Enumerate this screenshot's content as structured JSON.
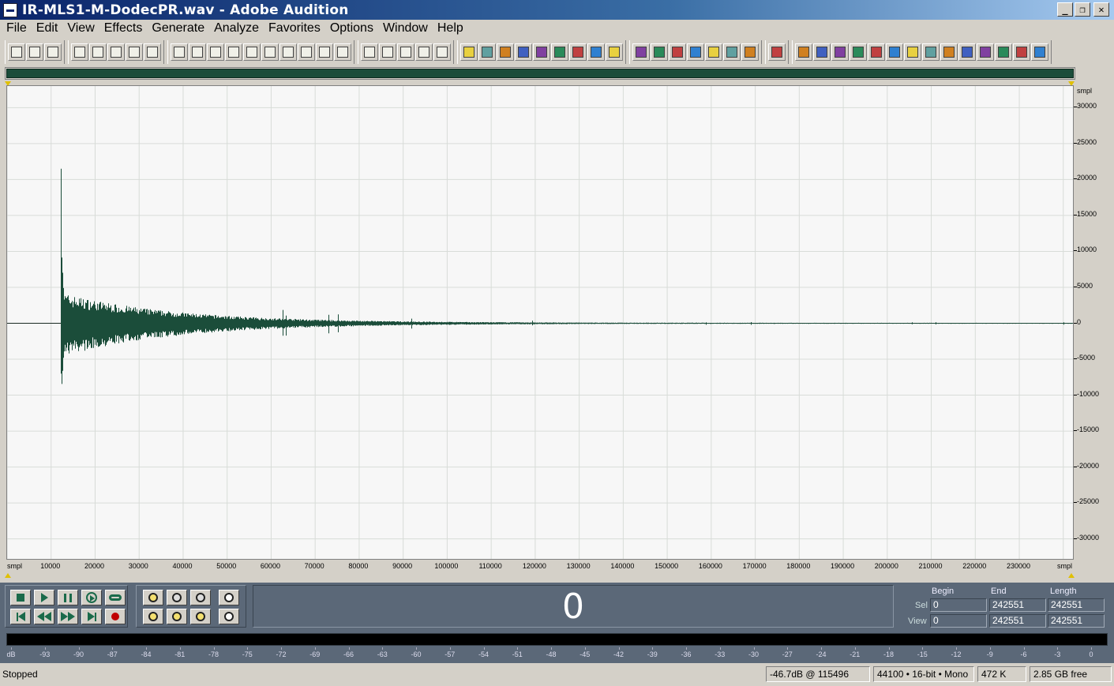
{
  "window": {
    "title": "IR-MLS1-M-DodecPR.wav - Adobe Audition",
    "buttons": [
      "_",
      "❐",
      "✕"
    ]
  },
  "menu": [
    "File",
    "Edit",
    "View",
    "Effects",
    "Generate",
    "Analyze",
    "Favorites",
    "Options",
    "Window",
    "Help"
  ],
  "waveform": {
    "x_unit": "smpl",
    "y_unit": "smpl",
    "x_ticks": [
      "10000",
      "20000",
      "30000",
      "40000",
      "50000",
      "60000",
      "70000",
      "80000",
      "90000",
      "100000",
      "110000",
      "120000",
      "130000",
      "140000",
      "150000",
      "160000",
      "170000",
      "180000",
      "190000",
      "200000",
      "210000",
      "220000",
      "230000"
    ],
    "y_ticks": [
      "30000",
      "25000",
      "20000",
      "15000",
      "10000",
      "5000",
      "0",
      "-5000",
      "-10000",
      "-15000",
      "-20000",
      "-25000",
      "-30000"
    ],
    "colors": {
      "wave": "#1b4d3a",
      "grid": "#d8dcd8",
      "background": "#f7f7f7"
    }
  },
  "transport": {
    "time": "0",
    "headers": {
      "begin": "Begin",
      "end": "End",
      "length": "Length"
    },
    "sel": {
      "label": "Sel",
      "begin": "0",
      "end": "242551",
      "length": "242551"
    },
    "view": {
      "label": "View",
      "begin": "0",
      "end": "242551",
      "length": "242551"
    }
  },
  "meter": {
    "scale": [
      "dB",
      "-93",
      "-90",
      "-87",
      "-84",
      "-81",
      "-78",
      "-75",
      "-72",
      "-69",
      "-66",
      "-63",
      "-60",
      "-57",
      "-54",
      "-51",
      "-48",
      "-45",
      "-42",
      "-39",
      "-36",
      "-33",
      "-30",
      "-27",
      "-24",
      "-21",
      "-18",
      "-15",
      "-12",
      "-9",
      "-6",
      "-3",
      "0"
    ]
  },
  "status": {
    "state": "Stopped",
    "level": "-46.7dB @ 115496",
    "format": "44100 • 16-bit • Mono",
    "size": "472 K",
    "free": "2.85 GB free"
  },
  "toolbar": {
    "icons": [
      "waveform-view-icon",
      "multitrack-view-icon",
      "cd-view-icon",
      "new-file-icon",
      "open-file-icon",
      "save-icon",
      "save-all-icon",
      "close-file-icon",
      "undo-icon",
      "redo-icon",
      "repeat-icon",
      "trim-icon",
      "copy-icon",
      "cut-icon",
      "paste-icon",
      "mix-paste-icon",
      "paste-new-icon",
      "crop-icon",
      "envelope-icon",
      "checkbox-icon",
      "grid-a-icon",
      "grid-b-icon",
      "grid-c-icon",
      "window-a-icon",
      "window-b-icon",
      "window-c-icon",
      "play-icon",
      "zoom-icon",
      "time-015-icon",
      "fader-icon",
      "rainbow-icon",
      "bar-icon",
      "effect-a-icon",
      "irs-icon",
      "mls-icon",
      "wave-icon",
      "sweep-icon",
      "effect-b-icon",
      "effect-c-icon",
      "scope-icon",
      "ap4-icon",
      "ap42-icon",
      "mq-icon",
      "vo-icon",
      "fx-a-icon",
      "fx-b-icon",
      "fx-c-icon",
      "fx-d-icon",
      "fx-e-icon",
      "fx-f-icon",
      "fx-g-icon",
      "itu-p56-icon",
      "sti-icon",
      "fx-h-icon"
    ]
  }
}
